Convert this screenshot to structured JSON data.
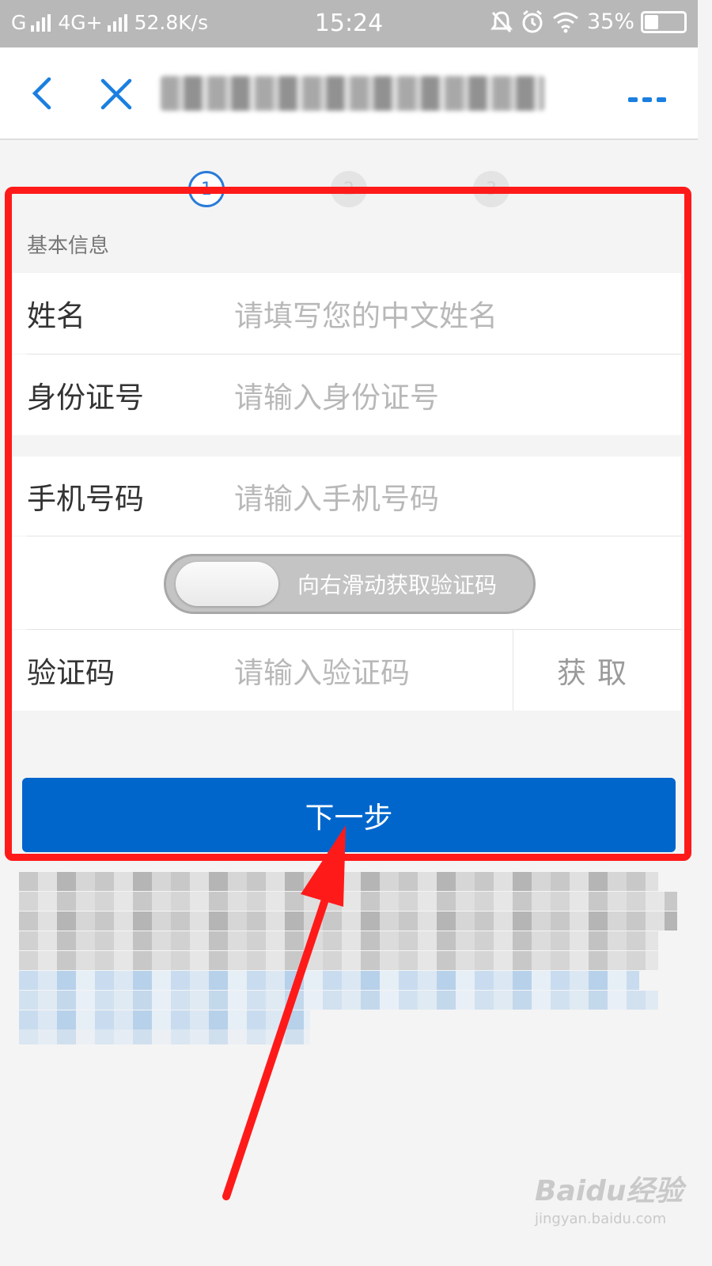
{
  "status_bar": {
    "carrier": "G",
    "network": "4G+",
    "speed": "52.8K/s",
    "time": "15:24",
    "battery": "35%",
    "battery_level": 0.35
  },
  "nav": {
    "back_icon": "chevron-left-icon",
    "close_icon": "close-icon",
    "more_icon": "more-icon"
  },
  "steps": [
    "1",
    "2",
    "3"
  ],
  "form": {
    "section_title": "基本信息",
    "name": {
      "label": "姓名",
      "placeholder": "请填写您的中文姓名"
    },
    "id_number": {
      "label": "身份证号",
      "placeholder": "请输入身份证号"
    },
    "phone": {
      "label": "手机号码",
      "placeholder": "请输入手机号码"
    },
    "slider_text": "向右滑动获取验证码",
    "code": {
      "label": "验证码",
      "placeholder": "请输入验证码",
      "get_label": "获取"
    }
  },
  "next_button": "下一步",
  "watermark": {
    "main": "Baidu经验",
    "sub": "jingyan.baidu.com"
  },
  "colors": {
    "accent": "#0066cc",
    "highlight": "#ff1a1a"
  }
}
